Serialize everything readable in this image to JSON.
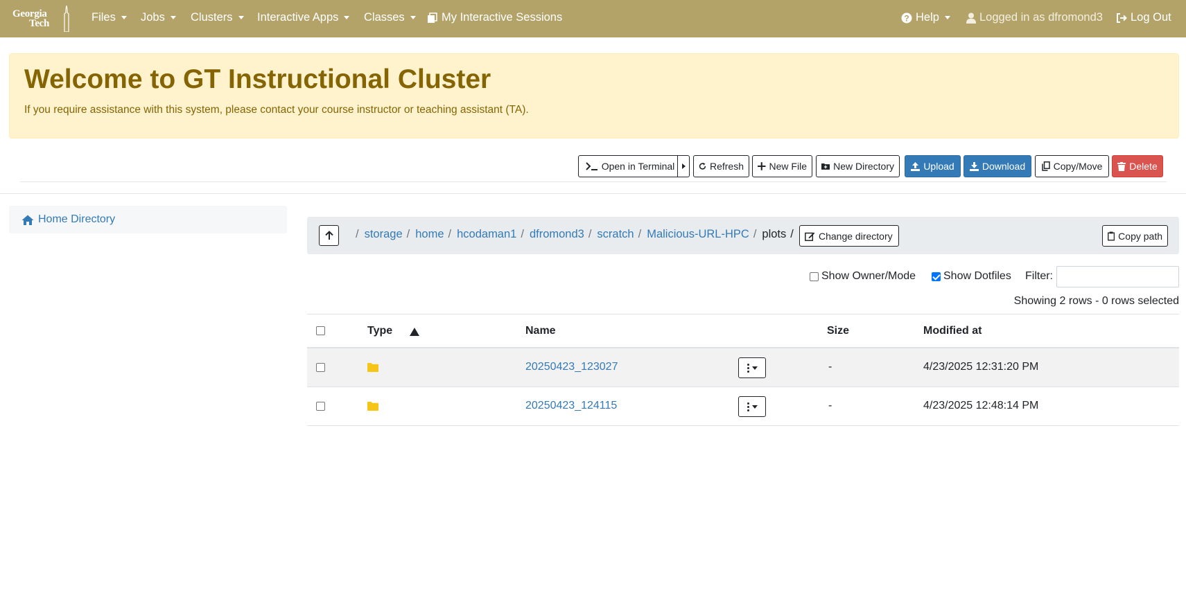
{
  "navbar": {
    "logo": {
      "line1": "Georgia",
      "line2": "Tech"
    },
    "items": [
      {
        "label": "Files",
        "icon": ""
      },
      {
        "label": "Jobs",
        "icon": ""
      },
      {
        "label": "Clusters",
        "icon": ""
      },
      {
        "label": "Interactive Apps",
        "icon": ""
      },
      {
        "label": "Classes",
        "icon": ""
      },
      {
        "label": "My Interactive Sessions",
        "icon": "sessions-icon"
      }
    ],
    "help": "Help",
    "logged_in": "Logged in as dfromond3",
    "logout": "Log Out",
    "bg_color": "#b3a369"
  },
  "alert": {
    "title": "Welcome to GT Instructional Cluster",
    "message": "If you require assistance with this system, please contact your course instructor or teaching assistant (TA)."
  },
  "toolbar": {
    "open_terminal": "Open in Terminal",
    "refresh": "Refresh",
    "new_file": "New File",
    "new_directory": "New Directory",
    "upload": "Upload",
    "download": "Download",
    "copy_move": "Copy/Move",
    "delete": "Delete"
  },
  "sidebar": {
    "home_directory": "Home Directory"
  },
  "breadcrumb": {
    "root_sep": "/",
    "parts": [
      "storage",
      "home",
      "hcodaman1",
      "dfromond3",
      "scratch",
      "Malicious-URL-HPC"
    ],
    "current": "plots",
    "change_directory": "Change directory",
    "copy_path": "Copy path"
  },
  "options": {
    "show_owner_mode": "Show Owner/Mode",
    "show_owner_mode_checked": false,
    "show_dotfiles": "Show Dotfiles",
    "show_dotfiles_checked": true,
    "filter_label": "Filter:",
    "filter_value": ""
  },
  "status": {
    "showing": "Showing 2 rows - 0 rows selected"
  },
  "table": {
    "headers": {
      "type": "Type",
      "name": "Name",
      "size": "Size",
      "modified": "Modified at"
    },
    "rows": [
      {
        "type": "folder",
        "name": "20250423_123027",
        "size": "-",
        "modified": "4/23/2025 12:31:20 PM"
      },
      {
        "type": "folder",
        "name": "20250423_124115",
        "size": "-",
        "modified": "4/23/2025 12:48:14 PM"
      }
    ]
  },
  "colors": {
    "link": "#337ab7",
    "folder": "#f5c518",
    "primary": "#337ab7",
    "danger": "#d9534f",
    "alert_bg": "#fff3cd",
    "alert_text": "#856404"
  }
}
